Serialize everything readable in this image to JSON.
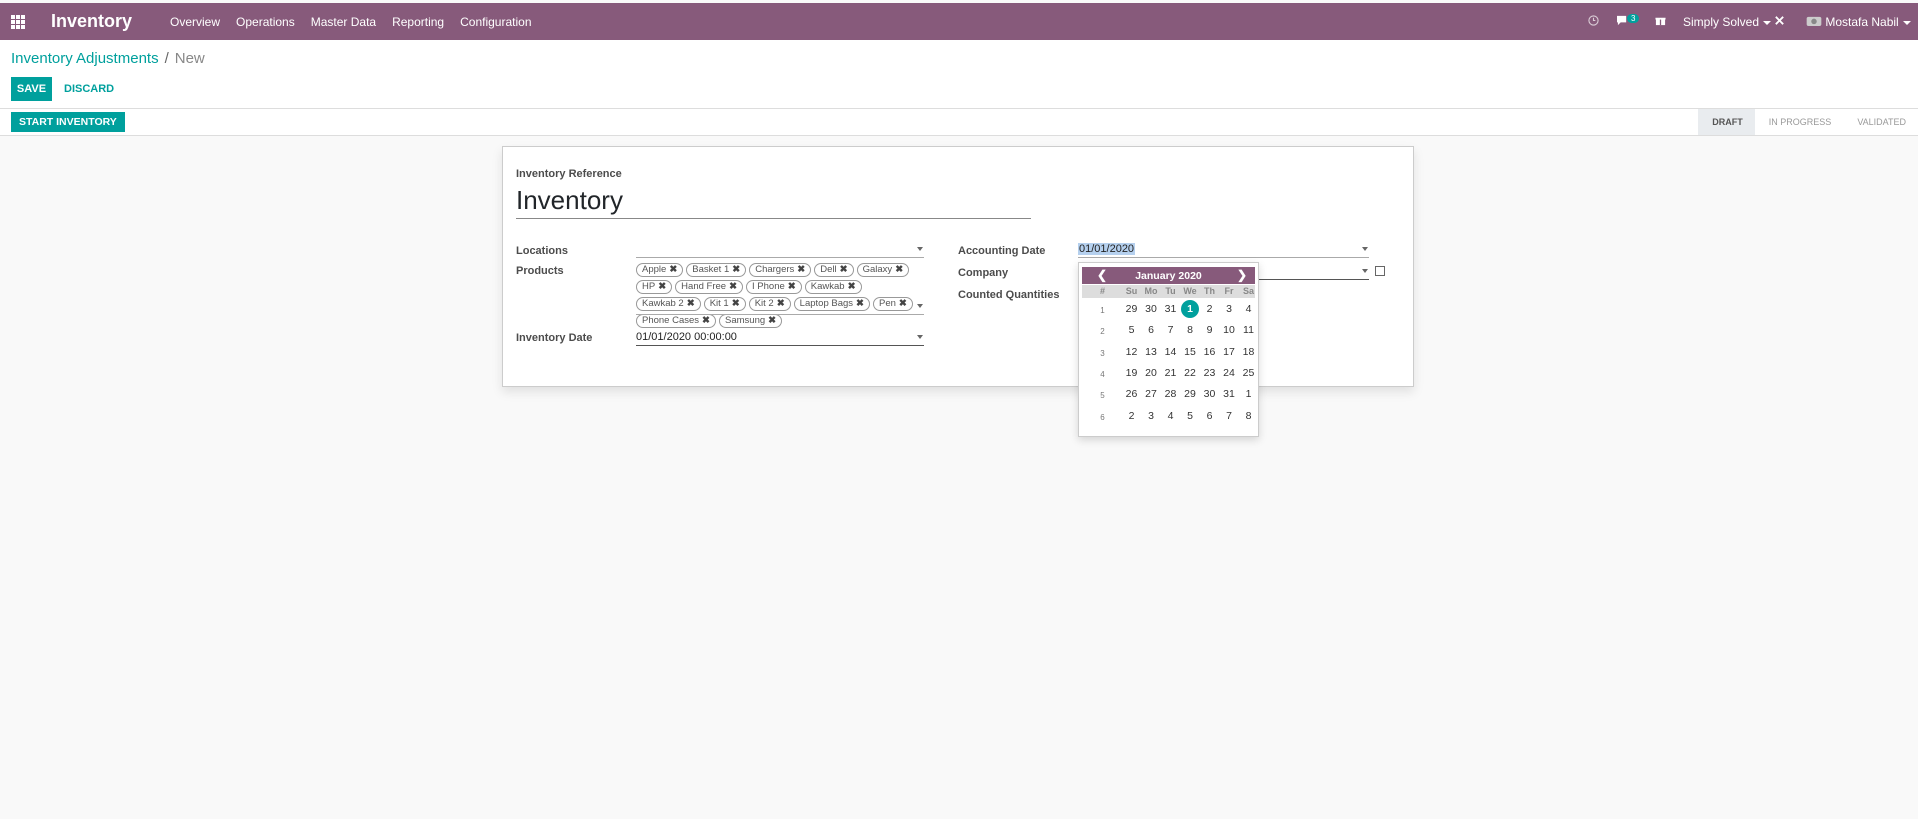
{
  "topbar": {
    "brand": "Inventory",
    "menu": [
      "Overview",
      "Operations",
      "Master Data",
      "Reporting",
      "Configuration"
    ],
    "messages_count": "3",
    "company": "Simply Solved",
    "user": "Mostafa Nabil"
  },
  "breadcrumb": {
    "parent": "Inventory Adjustments",
    "separator": "/",
    "current": "New"
  },
  "buttons": {
    "save": "SAVE",
    "discard": "DISCARD",
    "start": "START INVENTORY"
  },
  "stages": [
    "DRAFT",
    "IN PROGRESS",
    "VALIDATED"
  ],
  "form": {
    "reference_label": "Inventory Reference",
    "reference_value": "Inventory",
    "locations_label": "Locations",
    "products_label": "Products",
    "products": [
      "Apple",
      "Basket 1",
      "Chargers",
      "Dell",
      "Galaxy",
      "HP",
      "Hand Free",
      "I Phone",
      "Kawkab",
      "Kawkab 2",
      "Kit 1",
      "Kit 2",
      "Laptop Bags",
      "Pen",
      "Phone Cases",
      "Samsung"
    ],
    "inventory_date_label": "Inventory Date",
    "inventory_date_value": "01/01/2020 00:00:00",
    "accounting_date_label": "Accounting Date",
    "accounting_date_value": "01/01/2020",
    "company_label": "Company",
    "counted_label": "Counted Quantities"
  },
  "datepicker": {
    "month": "January 2020",
    "week_header": "#",
    "days": [
      "Su",
      "Mo",
      "Tu",
      "We",
      "Th",
      "Fr",
      "Sa"
    ],
    "weeks": [
      {
        "w": "1",
        "d": [
          "29",
          "30",
          "31",
          "1",
          "2",
          "3",
          "4"
        ]
      },
      {
        "w": "2",
        "d": [
          "5",
          "6",
          "7",
          "8",
          "9",
          "10",
          "11"
        ]
      },
      {
        "w": "3",
        "d": [
          "12",
          "13",
          "14",
          "15",
          "16",
          "17",
          "18"
        ]
      },
      {
        "w": "4",
        "d": [
          "19",
          "20",
          "21",
          "22",
          "23",
          "24",
          "25"
        ]
      },
      {
        "w": "5",
        "d": [
          "26",
          "27",
          "28",
          "29",
          "30",
          "31",
          "1"
        ]
      },
      {
        "w": "6",
        "d": [
          "2",
          "3",
          "4",
          "5",
          "6",
          "7",
          "8"
        ]
      }
    ],
    "selected": "1"
  },
  "colors": {
    "brand": "#875a7b",
    "accent": "#00a09d"
  }
}
